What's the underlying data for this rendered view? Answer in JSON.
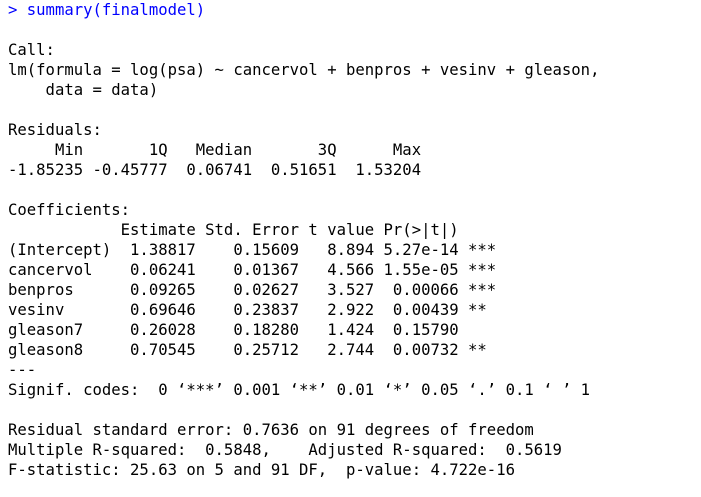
{
  "console": {
    "command": "> summary(finalmodel)",
    "output_lines": [
      "",
      "Call:",
      "lm(formula = log(psa) ~ cancervol + benpros + vesinv + gleason,",
      "    data = data)",
      "",
      "Residuals:",
      "     Min       1Q   Median       3Q      Max ",
      "-1.85235 -0.45777  0.06741  0.51651  1.53204 ",
      "",
      "Coefficients:",
      "            Estimate Std. Error t value Pr(>|t|)    ",
      "(Intercept)  1.38817    0.15609   8.894 5.27e-14 ***",
      "cancervol    0.06241    0.01367   4.566 1.55e-05 ***",
      "benpros      0.09265    0.02627   3.527  0.00066 ***",
      "vesinv       0.69646    0.23837   2.922  0.00439 ** ",
      "gleason7     0.26028    0.18280   1.424  0.15790    ",
      "gleason8     0.70545    0.25712   2.744  0.00732 ** ",
      "---",
      "Signif. codes:  0 ‘***’ 0.001 ‘**’ 0.01 ‘*’ 0.05 ‘.’ 0.1 ‘ ’ 1",
      "",
      "Residual standard error: 0.7636 on 91 degrees of freedom",
      "Multiple R-squared:  0.5848,    Adjusted R-squared:  0.5619 ",
      "F-statistic: 25.63 on 5 and 91 DF,  p-value: 4.722e-16"
    ]
  },
  "colors": {
    "command": "#0000ff",
    "output": "#000000",
    "background": "#ffffff"
  }
}
